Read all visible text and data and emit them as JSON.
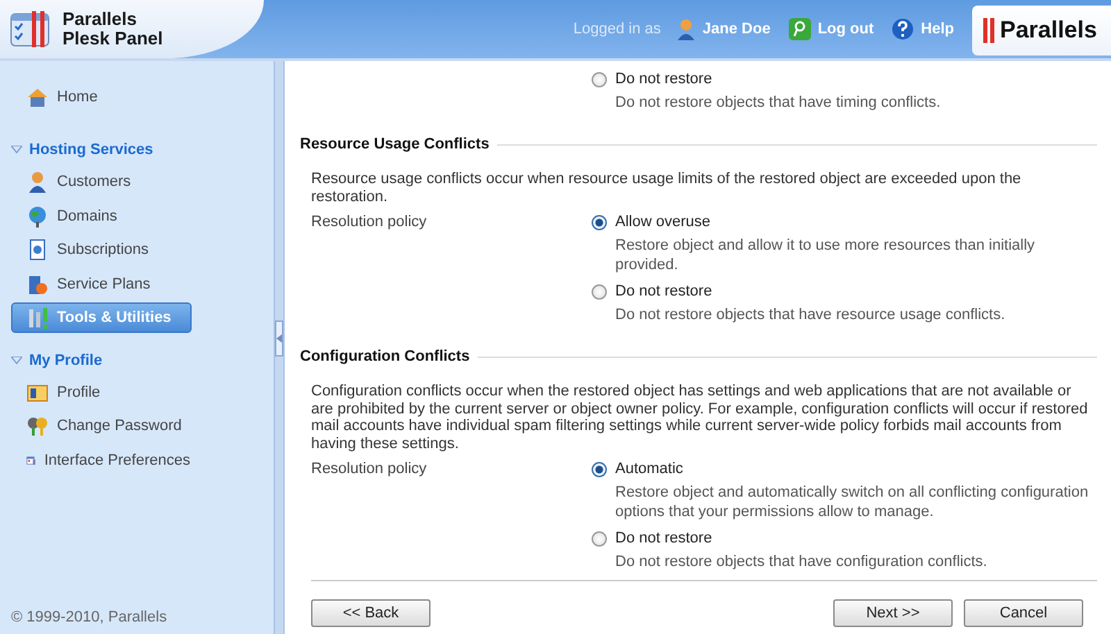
{
  "header": {
    "product_lines": [
      "Parallels",
      "Plesk Panel"
    ],
    "logged_in_label": "Logged in as",
    "user_name": "Jane Doe",
    "logout": "Log out",
    "help": "Help",
    "brand": "Parallels"
  },
  "sidebar": {
    "home": "Home",
    "groups": [
      {
        "title": "Hosting Services",
        "expanded": true,
        "items": [
          {
            "label": "Customers",
            "selected": false
          },
          {
            "label": "Domains",
            "selected": false
          },
          {
            "label": "Subscriptions",
            "selected": false
          },
          {
            "label": "Service Plans",
            "selected": false
          },
          {
            "label": "Tools & Utilities",
            "selected": true
          }
        ]
      },
      {
        "title": "My Profile",
        "expanded": true,
        "items": [
          {
            "label": "Profile",
            "selected": false
          },
          {
            "label": "Change Password",
            "selected": false
          },
          {
            "label": "Interface Preferences",
            "selected": false
          }
        ]
      }
    ],
    "copyright": "© 1999-2010, Parallels"
  },
  "content": {
    "top_options": [
      {
        "label": "Do not restore",
        "description": "Do not restore objects that have timing conflicts.",
        "selected": false
      }
    ],
    "sections": [
      {
        "title": "Resource Usage Conflicts",
        "description": "Resource usage conflicts occur when resource usage limits of the restored object are exceeded upon the restoration.",
        "policy_label": "Resolution policy",
        "options": [
          {
            "label": "Allow overuse",
            "description": "Restore object and allow it to use more resources than initially provided.",
            "selected": true
          },
          {
            "label": "Do not restore",
            "description": "Do not restore objects that have resource usage conflicts.",
            "selected": false
          }
        ]
      },
      {
        "title": "Configuration Conflicts",
        "description": "Configuration conflicts occur when the restored object has settings and web applications that are not available or are prohibited by the current server or object owner policy. For example, configuration conflicts will occur if restored mail accounts have individual spam filtering settings while current server-wide policy forbids mail accounts from having these settings.",
        "policy_label": "Resolution policy",
        "options": [
          {
            "label": "Automatic",
            "description": "Restore object and automatically switch on all conflicting configuration options that your permissions allow to manage.",
            "selected": true
          },
          {
            "label": "Do not restore",
            "description": "Do not restore objects that have configuration conflicts.",
            "selected": false
          }
        ]
      }
    ],
    "buttons": [
      {
        "label": "<< Back",
        "kind": "back"
      },
      {
        "label": "Next >>",
        "kind": "next"
      },
      {
        "label": "Cancel",
        "kind": "cancel"
      }
    ]
  }
}
